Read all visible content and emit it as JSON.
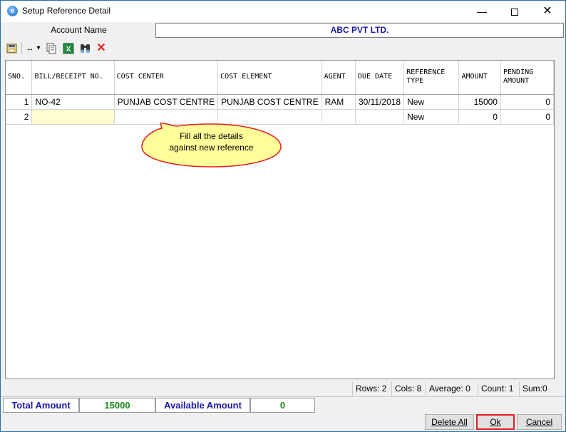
{
  "window": {
    "title": "Setup Reference Detail"
  },
  "account": {
    "label": "Account Name",
    "value": "ABC PVT LTD."
  },
  "toolbar": {
    "icons": [
      "save-layout-icon",
      "column-width-icon",
      "copy-icon",
      "excel-icon",
      "find-icon",
      "delete-icon"
    ],
    "dropdown_glyph": "▾"
  },
  "grid": {
    "columns": [
      "SNO.",
      "BILL/RECEIPT NO.",
      "COST CENTER",
      "COST ELEMENT",
      "AGENT",
      "DUE DATE",
      "REFERENCE TYPE",
      "AMOUNT",
      "PENDING AMOUNT"
    ],
    "rows": [
      {
        "sno": "1",
        "bill": "NO-42",
        "cost_center": "PUNJAB COST CENTRE",
        "cost_element": "PUNJAB COST CENTRE",
        "agent": "RAM",
        "due_date": "30/11/2018",
        "ref_type": "New",
        "amount": "15000",
        "pending": "0"
      },
      {
        "sno": "2",
        "bill": "",
        "cost_center": "",
        "cost_element": "",
        "agent": "",
        "due_date": "",
        "ref_type": "New",
        "amount": "0",
        "pending": "0"
      }
    ]
  },
  "callout": {
    "line1": "Fill all the details",
    "line2": "against new reference"
  },
  "status": {
    "rows": "Rows: 2",
    "cols": "Cols: 8",
    "average": "Average: 0",
    "count": "Count: 1",
    "sum": "Sum:0"
  },
  "totals": {
    "total_label": "Total Amount",
    "total_value": "15000",
    "available_label": "Available Amount",
    "available_value": "0"
  },
  "buttons": {
    "delete_all": "Delete All",
    "ok": "Ok",
    "cancel": "Cancel"
  },
  "colors": {
    "label_blue": "#1a1aa6",
    "value_green": "#1a8a1a",
    "callout_fill": "#fffe9a",
    "callout_border": "#e02020"
  }
}
